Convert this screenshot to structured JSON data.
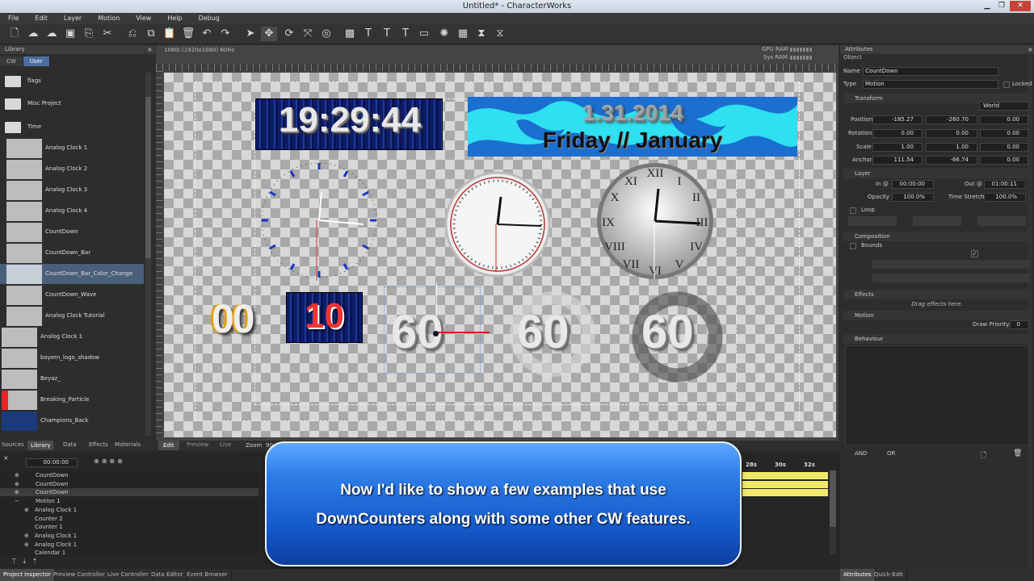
{
  "window": {
    "title": "Untitled* - CharacterWorks"
  },
  "menu": [
    "File",
    "Edit",
    "Layer",
    "Motion",
    "View",
    "Help",
    "Debug"
  ],
  "library": {
    "header": "Library",
    "tabs": [
      "CW",
      "User"
    ],
    "folders": [
      "flags",
      "Misc Project",
      "Time"
    ],
    "items": [
      "Analog Clock 1",
      "Analog Clock 2",
      "Analog Clock 3",
      "Analog Clock 4",
      "CountDown",
      "CountDown_Bar",
      "CountDown_Bar_Color_Change",
      "CountDown_Wave",
      "Analog Clock Tutorial",
      "Analog Clock 1",
      "bayern_logo_shadow",
      "Beyaz_",
      "Breaking_Particle",
      "Champions_Back"
    ],
    "bottom_tabs": [
      "Sources",
      "Library",
      "Data",
      "Effects",
      "Materials"
    ]
  },
  "viewport": {
    "resolution": "1080i (1920x1080) 60Hz",
    "gpu_ram": "GPU RAM",
    "sys_ram": "Sys RAM",
    "tabs": [
      "Edit",
      "Preview",
      "Live"
    ],
    "zoom_label": "Zoom",
    "zoom_value": "90",
    "time_big": "19:29:44",
    "date": "1.31.2014",
    "day_month": "Friday  // January",
    "counter_a": "00",
    "counter_b": "10",
    "counter_c": "60",
    "counter_d": "60",
    "counter_e": "60"
  },
  "attributes": {
    "header": "Attributes",
    "section": "Object",
    "name_label": "Name",
    "name_value": "CountDown",
    "type_label": "Type",
    "type_value": "Motion",
    "locked": "Locked",
    "transform": "Transform",
    "space": "World",
    "position_label": "Position",
    "position": [
      "-185.27",
      "-260.70",
      "0.00"
    ],
    "rotation_label": "Rotation",
    "rotation": [
      "0.00",
      "0.00",
      "0.00"
    ],
    "scale_label": "Scale",
    "scale": [
      "1.00",
      "1.00",
      "0.00"
    ],
    "anchor_label": "Anchor",
    "anchor": [
      "111.54",
      "-66.74",
      "0.00"
    ],
    "layer": "Layer",
    "in_label": "In @",
    "in_value": "00:00:00",
    "out_label": "Out @",
    "out_value": "01:00:11",
    "opacity_label": "Opacity",
    "opacity": "100.0%",
    "stretch_label": "Time Stretch",
    "stretch": "100.0%",
    "loop": "Loop",
    "composition": "Composition",
    "bounds": "Bounds",
    "effects": "Effects",
    "drag_effects": "Drag effects here.",
    "motion": "Motion",
    "draw_priority_label": "Draw Priority",
    "draw_priority": "0",
    "behaviour": "Behaviour",
    "and": "AND",
    "or": "OR"
  },
  "timeline": {
    "time": "00:00:00",
    "tracks": [
      "CountDown",
      "CountDown",
      "CountDown",
      "Motion 1",
      "Analog Clock 1",
      "Counter 2",
      "Counter 1",
      "Analog Clock 1",
      "Analog Clock 1",
      "Calendar 1"
    ],
    "ruler": [
      "28s",
      "30s",
      "32s"
    ]
  },
  "status_tabs": [
    "Project Inspector",
    "Preview Controller",
    "Live Controller",
    "Data Editor",
    "Event Browser"
  ],
  "right_status_tabs": [
    "Attributes",
    "Quick-Edit"
  ],
  "banner": {
    "line1": "Now I'd like to show a few examples that use",
    "line2": "DownCounters along with some other CW features."
  }
}
